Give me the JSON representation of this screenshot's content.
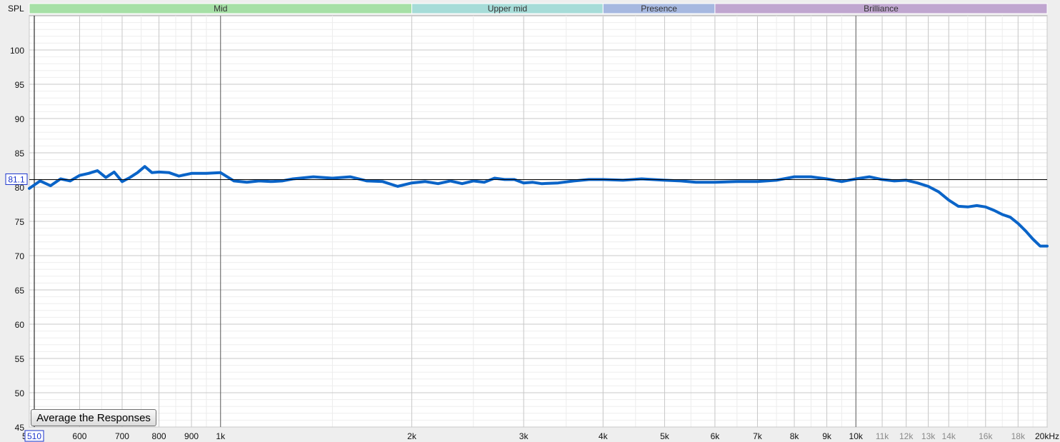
{
  "colors": {
    "background": "#eeeeee",
    "plot_background": "#ffffff",
    "curve": "#0a64c8",
    "cursor_line": "#000000",
    "cursor_label": "#1a33cc"
  },
  "band_labels": [
    {
      "name": "Mid",
      "from": 500,
      "to": 2000,
      "color": "#a6e0a6"
    },
    {
      "name": "Upper mid",
      "from": 2000,
      "to": 4000,
      "color": "#a6dcd8"
    },
    {
      "name": "Presence",
      "from": 4000,
      "to": 6000,
      "color": "#a6b8e0"
    },
    {
      "name": "Brilliance",
      "from": 6000,
      "to": 20000,
      "color": "#c0a6d0"
    }
  ],
  "controls": {
    "average_button": "Average the Responses"
  },
  "cursor": {
    "value_label": "81.1",
    "start_label": "510"
  },
  "chart_data": {
    "type": "line",
    "title": "",
    "ylabel": "SPL",
    "xlabel": "",
    "x_scale": "log",
    "xlim": [
      500,
      20000
    ],
    "ylim": [
      45,
      105
    ],
    "grid": true,
    "cursor_y": 81.1,
    "y_ticks": [
      "45",
      "50",
      "55",
      "60",
      "65",
      "70",
      "75",
      "80",
      "85",
      "90",
      "95",
      "100"
    ],
    "y_tick_values": [
      45,
      50,
      55,
      60,
      65,
      70,
      75,
      80,
      85,
      90,
      95,
      100
    ],
    "x_tick_labels": [
      "5",
      "600",
      "700",
      "800",
      "900",
      "1k",
      "2k",
      "3k",
      "4k",
      "5k",
      "6k",
      "7k",
      "8k",
      "9k",
      "10k",
      "11k",
      "12k",
      "13k",
      "14k",
      "16k",
      "18k",
      "20kHz"
    ],
    "x_tick_values": [
      500,
      600,
      700,
      800,
      900,
      1000,
      2000,
      3000,
      4000,
      5000,
      6000,
      7000,
      8000,
      9000,
      10000,
      11000,
      12000,
      13000,
      14000,
      16000,
      18000,
      20000
    ],
    "x_tick_grey": [
      false,
      false,
      false,
      false,
      false,
      false,
      false,
      false,
      false,
      false,
      false,
      false,
      false,
      false,
      false,
      true,
      true,
      true,
      true,
      true,
      true,
      false
    ],
    "series": [
      {
        "x": [
          500,
          520,
          540,
          560,
          580,
          600,
          620,
          640,
          660,
          680,
          700,
          720,
          740,
          760,
          780,
          800,
          830,
          860,
          900,
          950,
          1000,
          1050,
          1100,
          1150,
          1200,
          1250,
          1300,
          1400,
          1500,
          1600,
          1700,
          1800,
          1900,
          2000,
          2100,
          2200,
          2300,
          2400,
          2500,
          2600,
          2700,
          2800,
          2900,
          3000,
          3100,
          3200,
          3400,
          3600,
          3800,
          4000,
          4300,
          4600,
          5000,
          5300,
          5600,
          6000,
          6500,
          7000,
          7500,
          8000,
          8500,
          9000,
          9500,
          10000,
          10500,
          11000,
          11500,
          12000,
          12500,
          13000,
          13500,
          14000,
          14500,
          15000,
          15500,
          16000,
          16500,
          17000,
          17500,
          18000,
          18500,
          19000,
          19500,
          20000
        ],
        "y": [
          79.8,
          80.9,
          80.2,
          81.2,
          80.9,
          81.7,
          82.0,
          82.4,
          81.4,
          82.2,
          80.8,
          81.4,
          82.1,
          83.0,
          82.1,
          82.2,
          82.1,
          81.6,
          82.0,
          82.0,
          82.1,
          80.9,
          80.7,
          80.9,
          80.8,
          80.9,
          81.2,
          81.5,
          81.3,
          81.5,
          80.9,
          80.8,
          80.1,
          80.6,
          80.8,
          80.5,
          80.9,
          80.5,
          80.9,
          80.7,
          81.3,
          81.1,
          81.1,
          80.6,
          80.7,
          80.5,
          80.6,
          80.9,
          81.1,
          81.1,
          81.0,
          81.2,
          81.0,
          80.9,
          80.7,
          80.7,
          80.8,
          80.8,
          81.0,
          81.5,
          81.5,
          81.2,
          80.8,
          81.2,
          81.5,
          81.1,
          80.9,
          81.0,
          80.6,
          80.1,
          79.3,
          78.1,
          77.2,
          77.1,
          77.3,
          77.1,
          76.6,
          76.0,
          75.6,
          74.7,
          73.6,
          72.4,
          71.4,
          71.4
        ]
      }
    ]
  }
}
